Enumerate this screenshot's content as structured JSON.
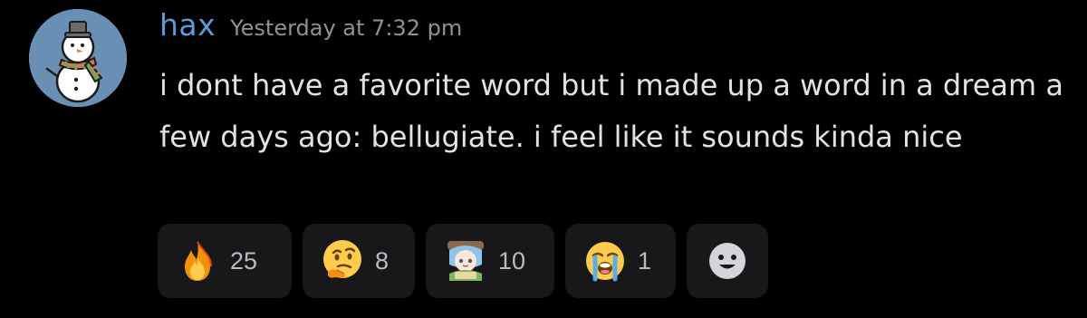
{
  "message": {
    "author": "hax",
    "timestamp": "Yesterday at 7:32 pm",
    "content": "i dont have a favorite word but i made up a word in a dream a few days ago: bellugiate. i feel like it sounds kinda nice"
  },
  "reactions": [
    {
      "emoji": "fire-emoji",
      "count": "25"
    },
    {
      "emoji": "thinking-face-emoji",
      "count": "8"
    },
    {
      "emoji": "custom-anime-character-emoji",
      "count": "10"
    },
    {
      "emoji": "loudly-crying-face-emoji",
      "count": "1"
    }
  ],
  "add_reaction": {
    "icon": "add-reaction-smiley-icon"
  },
  "colors": {
    "background": "#000000",
    "username": "#5b9bd8",
    "timestamp": "#8e9297",
    "text": "#e1e2e6",
    "reaction_bg": "#18181b",
    "avatar_bg": "#6a8fb4"
  }
}
